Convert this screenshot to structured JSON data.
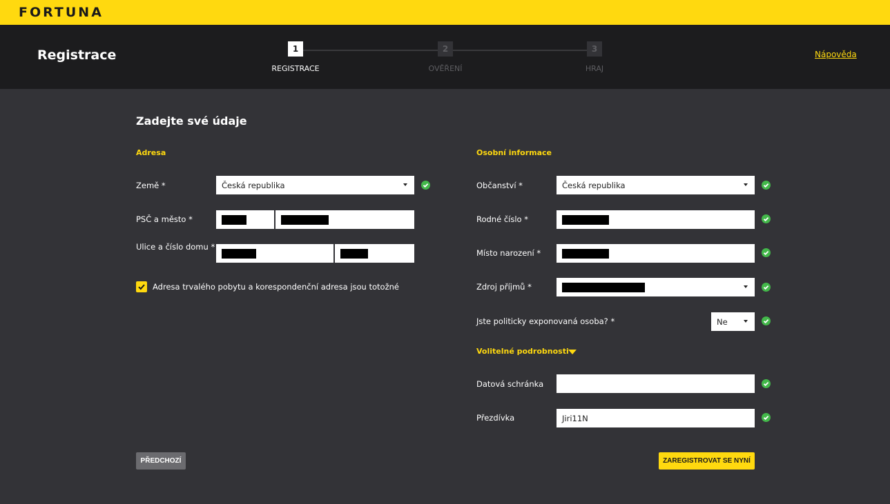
{
  "brand": {
    "logo_text": "FORTUNA",
    "accent_color": "#ffd90f"
  },
  "header": {
    "title": "Registrace",
    "help_link": "Nápověda",
    "steps": [
      {
        "number": "1",
        "label": "REGISTRACE",
        "state": "active"
      },
      {
        "number": "2",
        "label": "OVĚŘENÍ",
        "state": "inactive"
      },
      {
        "number": "3",
        "label": "HRAJ",
        "state": "inactive"
      }
    ]
  },
  "form": {
    "title": "Zadejte své údaje",
    "address": {
      "title": "Adresa",
      "country_label": "Země *",
      "country_value": "Česká republika",
      "zip_city_label": "PSČ a město *",
      "street_label": "Ulice a číslo domu *",
      "same_address_label": "Adresa trvalého pobytu a korespondenční adresa jsou totožné",
      "same_address_checked": true
    },
    "personal": {
      "title": "Osobní informace",
      "citizenship_label": "Občanství *",
      "citizenship_value": "Česká republika",
      "birth_number_label": "Rodné číslo *",
      "birth_place_label": "Místo narození *",
      "income_source_label": "Zdroj příjmů *",
      "pep_label": "Jste politicky exponovaná osoba? *",
      "pep_value": "Ne",
      "optional_toggle": "Volitelné podrobnosti",
      "data_box_label": "Datová schránka",
      "data_box_value": "",
      "nickname_label": "Přezdívka",
      "nickname_value": "Jiri11N"
    },
    "buttons": {
      "previous": "PŘEDCHOZÍ",
      "register": "ZAREGISTROVAT SE NYNÍ"
    },
    "valid_color": "#43b84a"
  }
}
